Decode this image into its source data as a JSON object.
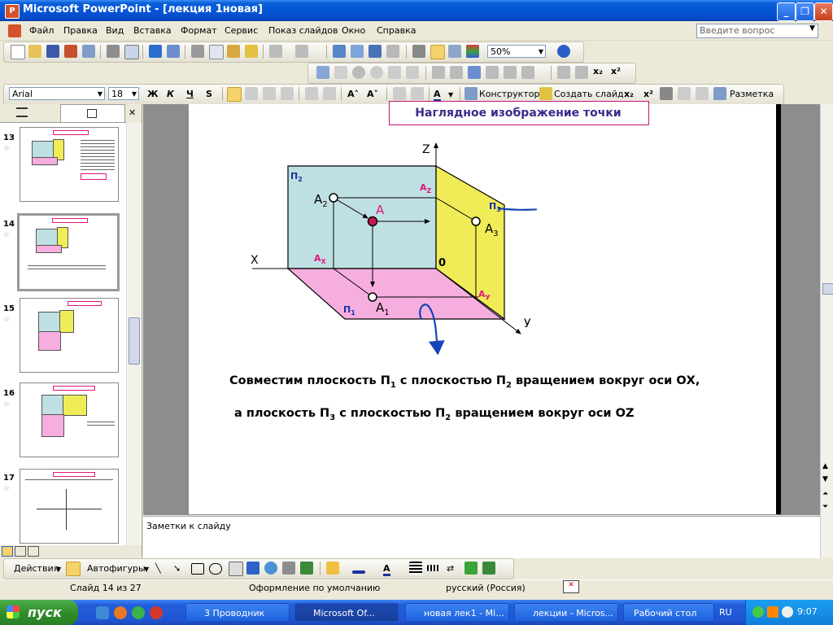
{
  "window": {
    "title": "Microsoft PowerPoint - [лекция 1новая]"
  },
  "menu": {
    "items": [
      "Файл",
      "Правка",
      "Вид",
      "Вставка",
      "Формат",
      "Сервис",
      "Показ слайдов",
      "Окно",
      "Справка"
    ],
    "help_placeholder": "Введите вопрос"
  },
  "standard_toolbar": {
    "zoom": "50%"
  },
  "formatting_toolbar": {
    "font": "Arial",
    "size": "18",
    "bold": "Ж",
    "italic": "К",
    "underline": "Ч",
    "shadow": "S",
    "designer": "Конструктор",
    "new_slide": "Создать слайд",
    "layout": "Разметка"
  },
  "slides_panel": {
    "thumbnails": [
      {
        "number": "13"
      },
      {
        "number": "14"
      },
      {
        "number": "15"
      },
      {
        "number": "16"
      },
      {
        "number": "17"
      }
    ]
  },
  "slide": {
    "title": "Наглядное изображение точки",
    "caption1": {
      "a": "Совместим плоскость П",
      "a_sub": "1",
      "b": " с плоскостью П",
      "b_sub": "2",
      "c": " вращением вокруг оси ОХ,"
    },
    "caption2": {
      "a": "а   плоскость П",
      "a_sub": "3",
      "b": " с плоскостью П",
      "b_sub": "2",
      "c": " вращением вокруг оси OZ"
    },
    "diagram": {
      "axis_z": "Z",
      "axis_x": "X",
      "axis_y": "У",
      "origin": "0",
      "plane_p2": "П",
      "plane_p2_sub": "2",
      "plane_p3": "П",
      "plane_p3_sub": "3",
      "plane_p1": "П",
      "plane_p1_sub": "1",
      "point_a": "A",
      "a2": "A",
      "a2_sub": "2",
      "a3": "A",
      "a3_sub": "3",
      "a1": "A",
      "a1_sub": "1",
      "az": "A",
      "az_sub": "Z",
      "ax": "A",
      "ax_sub": "X",
      "ay": "A",
      "ay_sub": "У",
      "colors": {
        "p2": "#bfe0e3",
        "p3": "#f0ec58",
        "p1": "#f6aede",
        "accent": "#e0177a",
        "arrow": "#1545b8"
      }
    }
  },
  "notes": {
    "placeholder": "Заметки к слайду"
  },
  "drawing_toolbar": {
    "actions": "Действия",
    "autoshapes": "Автофигуры"
  },
  "status": {
    "slide": "Слайд 14 из 27",
    "design": "Оформление по умолчанию",
    "language": "русский (Россия)"
  },
  "taskbar": {
    "start": "пуск",
    "tasks": [
      "3 Проводник",
      "Microsoft Of...",
      "новая лек1 - Mi...",
      "лекции - Micros...",
      "Рабочий стол"
    ],
    "lang": "RU",
    "clock": "9:07"
  }
}
